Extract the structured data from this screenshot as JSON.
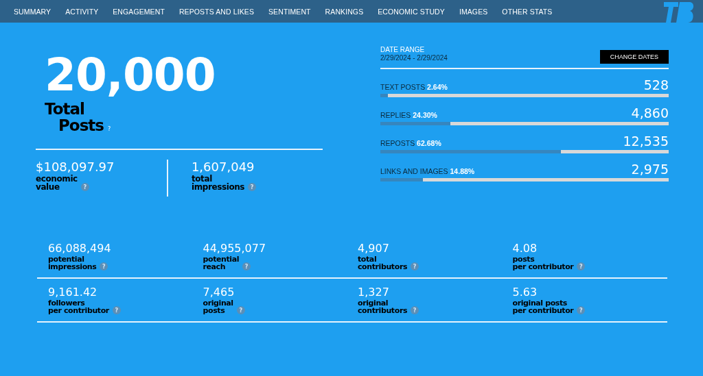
{
  "nav": [
    {
      "label": "SUMMARY",
      "selected": false
    },
    {
      "label": "ACTIVITY",
      "selected": false
    },
    {
      "label": "ENGAGEMENT",
      "selected": false
    },
    {
      "label": "REPOSTS AND LIKES",
      "selected": false
    },
    {
      "label": "SENTIMENT",
      "selected": false
    },
    {
      "label": "RANKINGS",
      "selected": false
    },
    {
      "label": "ECONOMIC STUDY",
      "selected": false
    },
    {
      "label": "IMAGES",
      "selected": false
    },
    {
      "label": "OTHER STATS",
      "selected": false
    }
  ],
  "total": {
    "value": "20,000",
    "label_lines": [
      "Total",
      "Posts"
    ],
    "help": "?"
  },
  "headline_stats": [
    {
      "value": "$108,097.97",
      "label_lines": [
        "economic",
        "value"
      ],
      "help": "?"
    },
    {
      "value": "1,607,049",
      "label_lines": [
        "total",
        "impressions"
      ],
      "help": "?"
    }
  ],
  "date_range": {
    "label": "DATE RANGE",
    "value": "2/29/2024 - 2/29/2024",
    "button": "CHANGE DATES"
  },
  "breakdown": [
    {
      "label": "TEXT POSTS",
      "percent": "2.64%",
      "count": "528",
      "level": 0.0264
    },
    {
      "label": "REPLIES",
      "percent": "24.30%",
      "count": "4,860",
      "level": 0.243
    },
    {
      "label": "REPOSTS",
      "percent": "62.68%",
      "count": "12,535",
      "level": 0.6268
    },
    {
      "label": "LINKS AND IMAGES",
      "percent": "14.88%",
      "count": "2,975",
      "level": 0.1488
    }
  ],
  "stat_rows": [
    [
      {
        "value": "66,088,494",
        "label_lines": [
          "potential",
          "impressions"
        ],
        "help": "?"
      },
      {
        "value": "44,955,077",
        "label_lines": [
          "potential",
          "reach"
        ],
        "help": "?"
      },
      {
        "value": "4,907",
        "label_lines": [
          "total",
          "contributors"
        ],
        "help": "?"
      },
      {
        "value": "4.08",
        "label_lines": [
          "posts",
          "per contributor"
        ],
        "help": "?"
      }
    ],
    [
      {
        "value": "9,161.42",
        "label_lines": [
          "followers",
          "per contributor"
        ],
        "help": "?"
      },
      {
        "value": "7,465",
        "label_lines": [
          "original",
          "posts"
        ],
        "help": "?"
      },
      {
        "value": "1,327",
        "label_lines": [
          "original",
          "contributors"
        ],
        "help": "?"
      },
      {
        "value": "5.63",
        "label_lines": [
          "original posts",
          "per contributor"
        ],
        "help": "?"
      }
    ]
  ]
}
